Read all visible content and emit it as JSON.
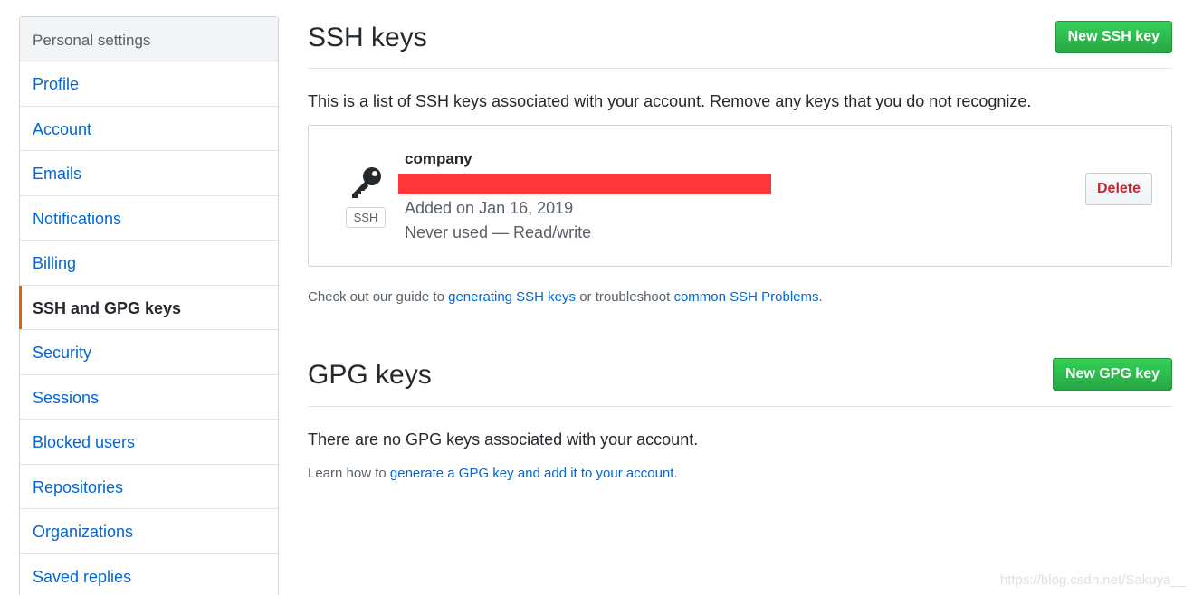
{
  "sidebar": {
    "header": "Personal settings",
    "items": [
      {
        "label": "Profile"
      },
      {
        "label": "Account"
      },
      {
        "label": "Emails"
      },
      {
        "label": "Notifications"
      },
      {
        "label": "Billing"
      },
      {
        "label": "SSH and GPG keys"
      },
      {
        "label": "Security"
      },
      {
        "label": "Sessions"
      },
      {
        "label": "Blocked users"
      },
      {
        "label": "Repositories"
      },
      {
        "label": "Organizations"
      },
      {
        "label": "Saved replies"
      }
    ],
    "selected_index": 5
  },
  "ssh": {
    "title": "SSH keys",
    "new_button": "New SSH key",
    "description": "This is a list of SSH keys associated with your account. Remove any keys that you do not recognize.",
    "keys": [
      {
        "title": "company",
        "type_label": "SSH",
        "added": "Added on Jan 16, 2019",
        "usage": "Never used — Read/write",
        "delete_label": "Delete"
      }
    ],
    "guide": {
      "prefix": "Check out our guide to ",
      "link1": "generating SSH keys",
      "middle": " or troubleshoot ",
      "link2": "common SSH Problems",
      "suffix": "."
    }
  },
  "gpg": {
    "title": "GPG keys",
    "new_button": "New GPG key",
    "empty_text": "There are no GPG keys associated with your account.",
    "learn": {
      "prefix": "Learn how to ",
      "link": "generate a GPG key and add it to your account",
      "suffix": "."
    }
  },
  "watermark": "https://blog.csdn.net/Sakuya__",
  "colors": {
    "link": "#0366d6",
    "selected_accent": "#e36209",
    "primary_button": "#28a745",
    "danger_text": "#cb2431",
    "redaction": "#fd363b"
  }
}
